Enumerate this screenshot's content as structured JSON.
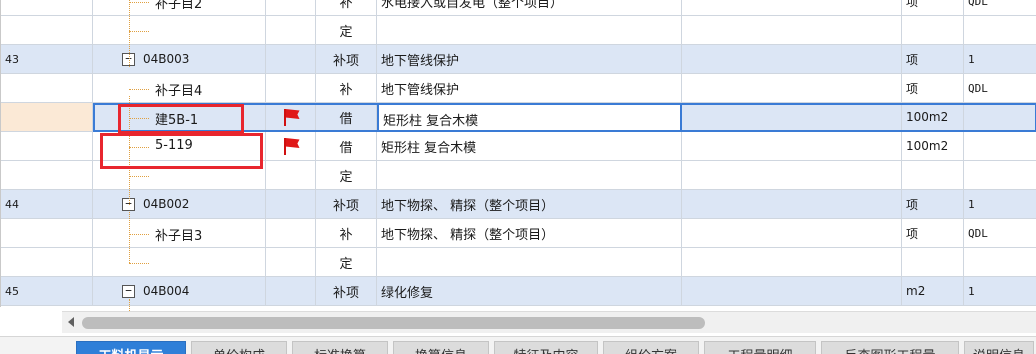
{
  "rows": [
    {
      "num": "",
      "code": "补子目2",
      "type": "补",
      "name": "水电接入或自发电（整个项目）",
      "unit": "项",
      "qty": "QDL",
      "band": false,
      "kind": "child"
    },
    {
      "num": "",
      "code": "",
      "type": "定",
      "name": "",
      "unit": "",
      "qty": "",
      "band": false,
      "kind": "child"
    },
    {
      "num": "43",
      "code": "04B003",
      "type": "补项",
      "name": "地下管线保护",
      "unit": "项",
      "qty": "1",
      "band": true,
      "kind": "parent"
    },
    {
      "num": "",
      "code": "补子目4",
      "type": "补",
      "name": "地下管线保护",
      "unit": "项",
      "qty": "QDL",
      "band": false,
      "kind": "child"
    },
    {
      "num": "",
      "code": "建5B-1",
      "type": "借",
      "name": "矩形柱 复合木模",
      "unit": "100m2",
      "qty": "",
      "band": false,
      "kind": "child",
      "flag": true,
      "selected": true
    },
    {
      "num": "",
      "code": "5-119",
      "type": "借",
      "name": "矩形柱 复合木模",
      "unit": "100m2",
      "qty": "",
      "band": false,
      "kind": "child",
      "flag": true
    },
    {
      "num": "",
      "code": "",
      "type": "定",
      "name": "",
      "unit": "",
      "qty": "",
      "band": false,
      "kind": "child"
    },
    {
      "num": "44",
      "code": "04B002",
      "type": "补项",
      "name": "地下物探、 精探（整个项目）",
      "unit": "项",
      "qty": "1",
      "band": true,
      "kind": "parent"
    },
    {
      "num": "",
      "code": "补子目3",
      "type": "补",
      "name": "地下物探、 精探（整个项目）",
      "unit": "项",
      "qty": "QDL",
      "band": false,
      "kind": "child"
    },
    {
      "num": "",
      "code": "",
      "type": "定",
      "name": "",
      "unit": "",
      "qty": "",
      "band": false,
      "kind": "child"
    },
    {
      "num": "45",
      "code": "04B004",
      "type": "补项",
      "name": "绿化修复",
      "unit": "m2",
      "qty": "1",
      "band": true,
      "kind": "parent"
    }
  ],
  "expander_symbol": "−",
  "icons": {
    "flag": "red-flag-icon",
    "scroll_left": "scroll-left-arrow-icon"
  },
  "colors": {
    "band": "#dce6f5",
    "selection": "#3a7bd5",
    "highlight": "#e8262e",
    "flag": "#e01818",
    "active_tab": "#2f7fd8"
  },
  "tabs": [
    {
      "label": "工料机显示",
      "active": true
    },
    {
      "label": "单价构成",
      "active": false
    },
    {
      "label": "标准换算",
      "active": false
    },
    {
      "label": "换算信息",
      "active": false
    },
    {
      "label": "特征及内容",
      "active": false
    },
    {
      "label": "组价方案",
      "active": false
    },
    {
      "label": "工程量明细",
      "active": false
    },
    {
      "label": "反查图形工程量",
      "active": false
    },
    {
      "label": "说明信息",
      "active": false
    }
  ]
}
